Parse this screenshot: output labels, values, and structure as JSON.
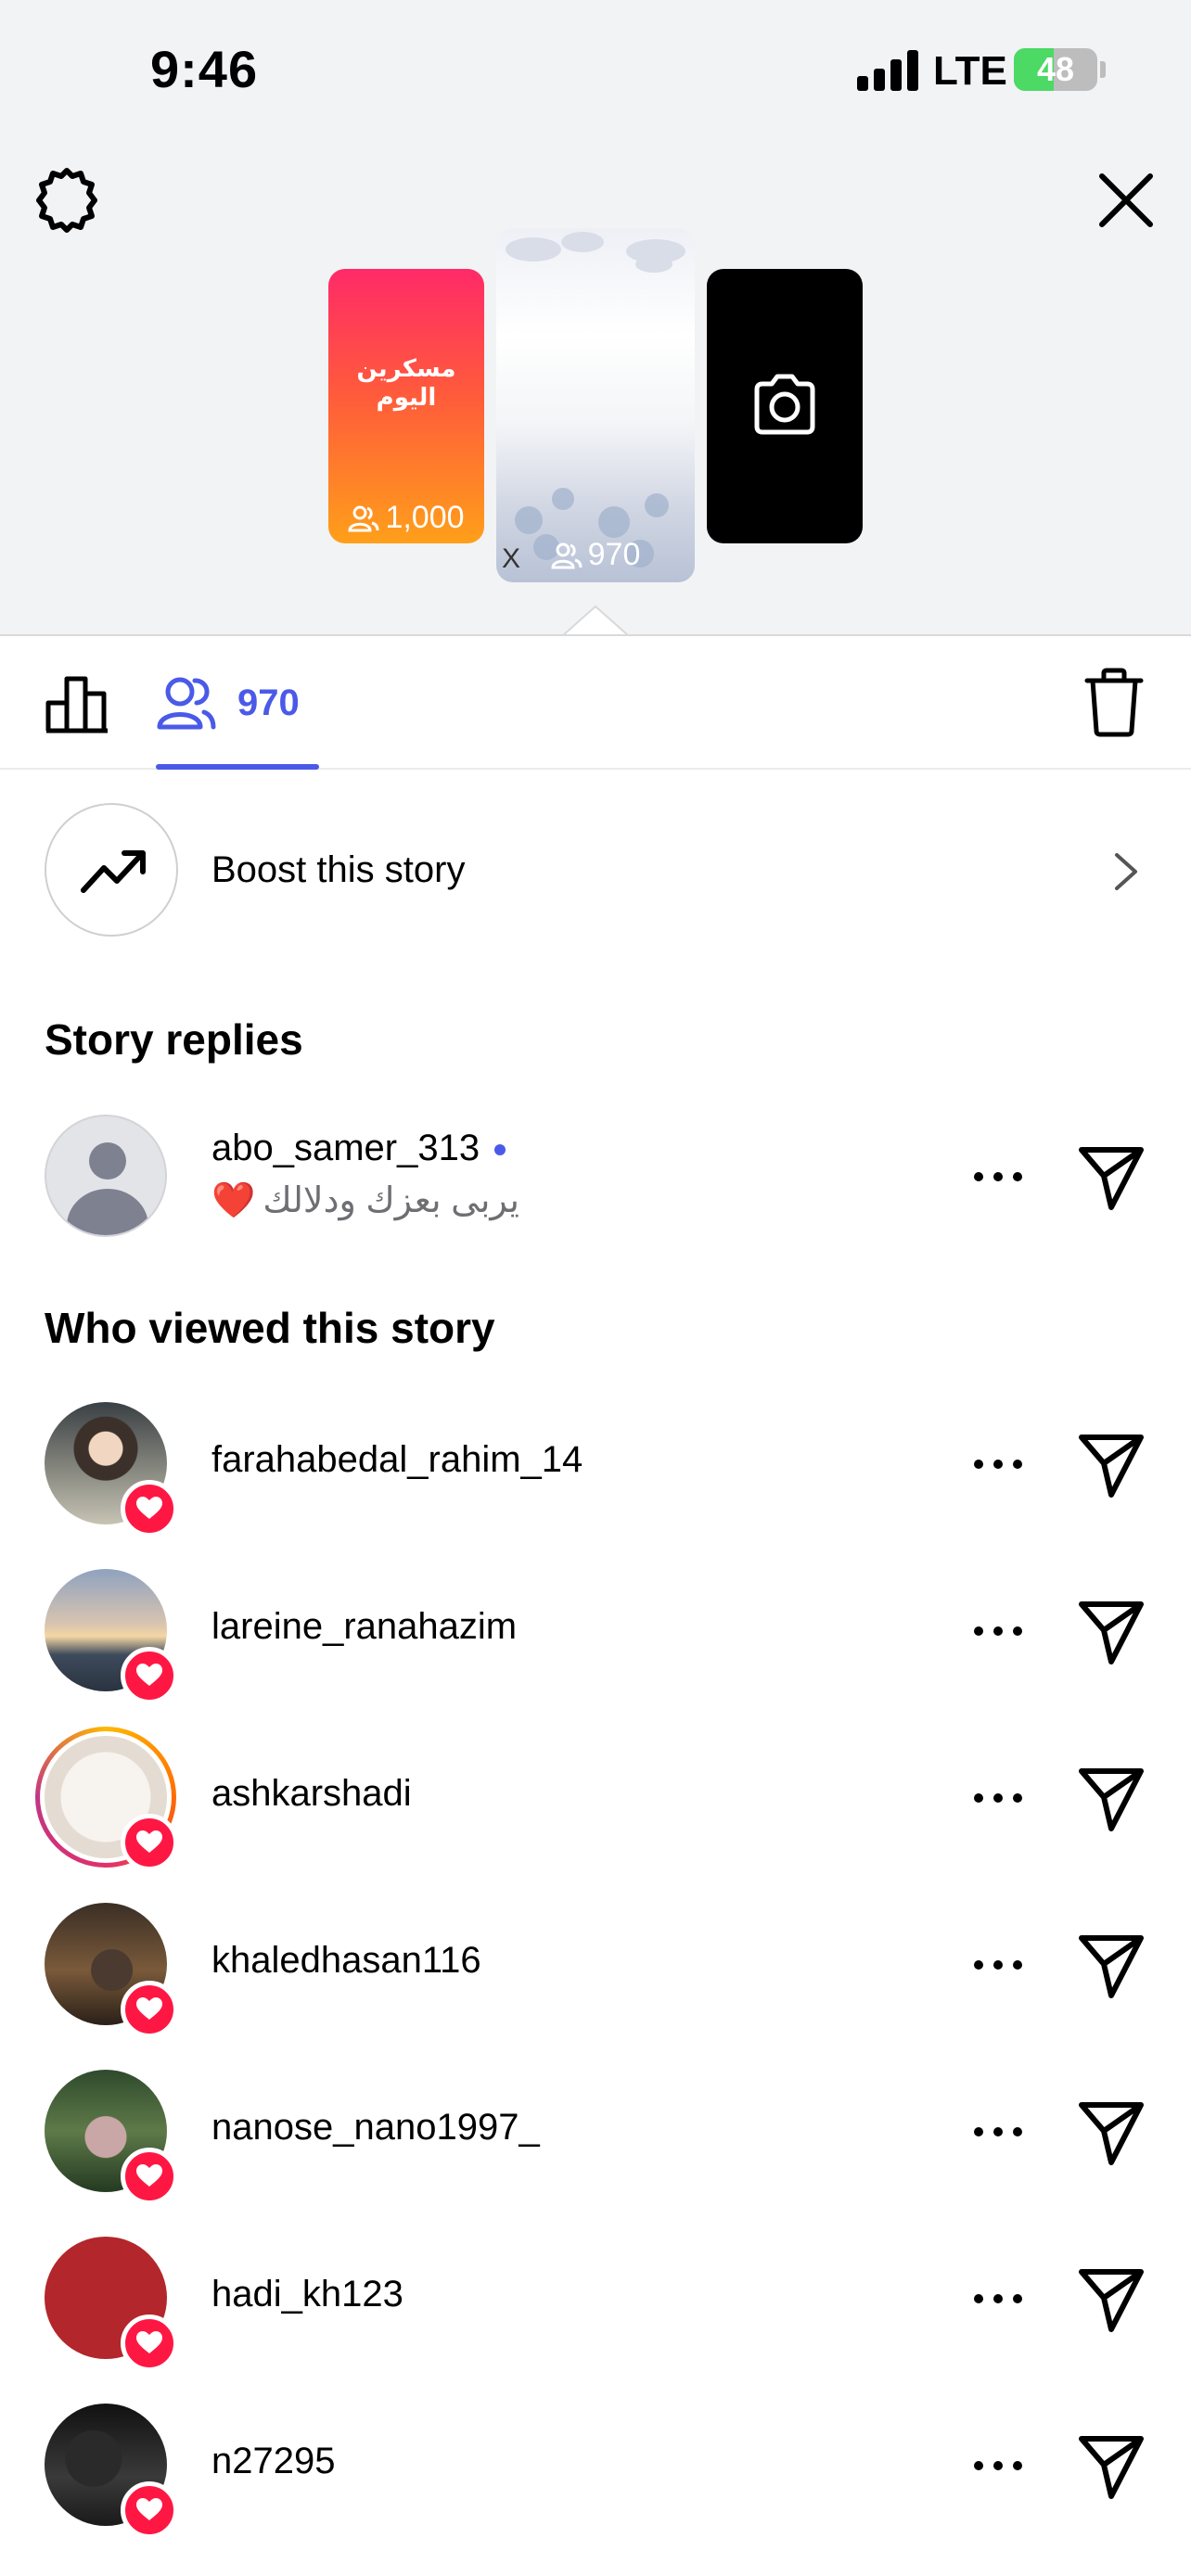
{
  "status_bar": {
    "time": "9:46",
    "network": "LTE",
    "battery": "48",
    "battery_level_percent": 48,
    "battery_color": "#4cd964"
  },
  "header": {
    "settings_icon": "gear-icon",
    "close_icon": "close-icon"
  },
  "thumbnails": {
    "previous": {
      "text": "مسكرين اليوم",
      "views": "1,000"
    },
    "current": {
      "views": "970",
      "mark": "X"
    },
    "add": {
      "icon": "camera-icon"
    }
  },
  "tabs": {
    "insights_icon": "bar-chart-icon",
    "viewers_count": "970",
    "delete_icon": "trash-icon",
    "accent_color": "#4a5ae8"
  },
  "boost": {
    "label": "Boost this story",
    "icon": "trending-up-icon"
  },
  "replies": {
    "title": "Story replies",
    "items": [
      {
        "username": "abo_samer_313",
        "reply": "يربى بعزك ودلالك",
        "emoji": "❤️"
      }
    ]
  },
  "viewers": {
    "title": "Who viewed this story",
    "items": [
      {
        "username": "farahabedal_rahim_14"
      },
      {
        "username": "lareine_ranahazim"
      },
      {
        "username": "ashkarshadi"
      },
      {
        "username": "khaledhasan116"
      },
      {
        "username": "nanose_nano1997_"
      },
      {
        "username": "hadi_kh123"
      },
      {
        "username": "n27295"
      }
    ]
  },
  "colors": {
    "like_badge": "#ff1744",
    "top_background": "#f2f3f5"
  }
}
